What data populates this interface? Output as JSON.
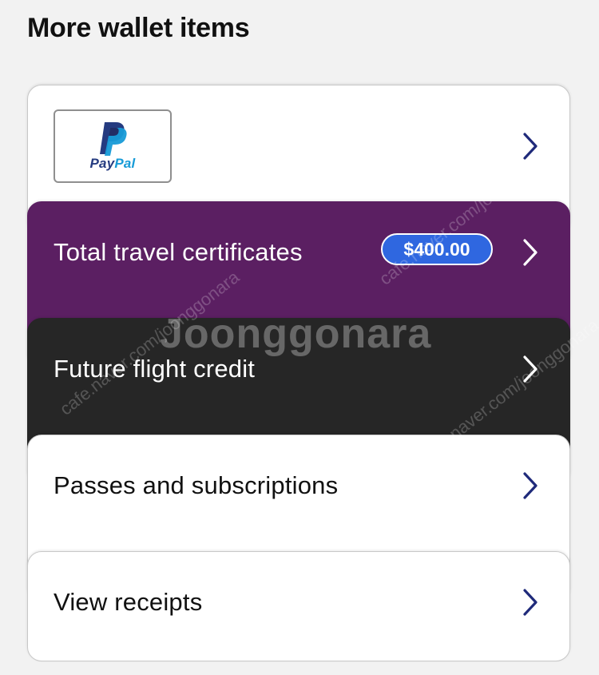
{
  "header": {
    "title": "More wallet items"
  },
  "cards": {
    "paypal": {
      "logo_pay": "Pay",
      "logo_pal": "Pal"
    },
    "travel": {
      "label": "Total travel certificates",
      "amount": "$400.00"
    },
    "future": {
      "label": "Future flight credit"
    },
    "passes": {
      "label": "Passes and subscriptions"
    },
    "receipts": {
      "label": "View receipts"
    }
  },
  "watermark": {
    "brand": "Joonggonara",
    "url": "cafe.naver.com/joonggonara"
  },
  "colors": {
    "travel_bg": "#5b1f62",
    "future_bg": "#262626",
    "badge_bg": "#2f67e0",
    "chevron_dark": "#1f2a7a",
    "chevron_light": "#ffffff"
  },
  "icons": {
    "chevron": "chevron-right-icon",
    "paypal": "paypal-logo"
  }
}
